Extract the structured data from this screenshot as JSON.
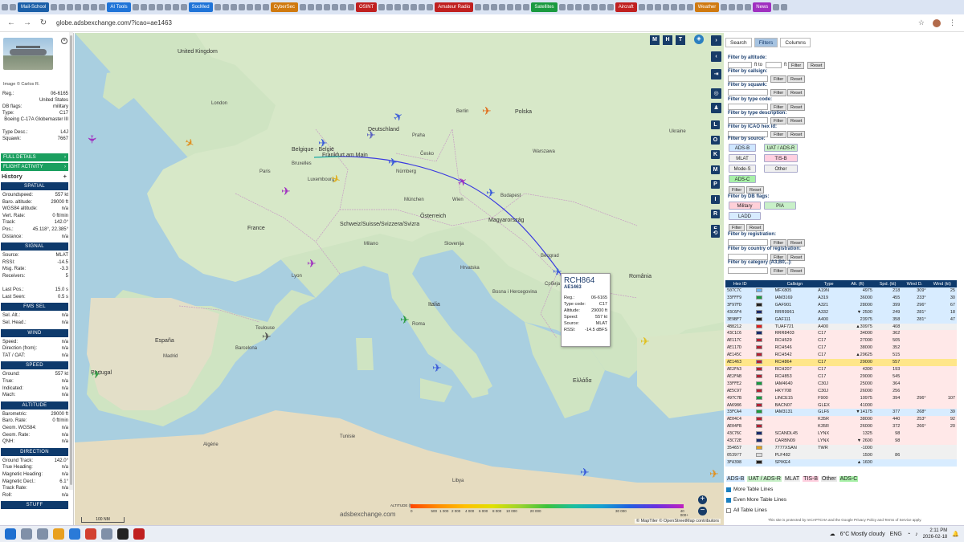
{
  "bookmarks": [
    {
      "label": "Mail-School",
      "color": "#1b5fa8"
    },
    {
      "label": "AI Tools",
      "color": "#1f74d8"
    },
    {
      "label": "SocMed",
      "color": "#1f74d8"
    },
    {
      "label": "CyberSec",
      "color": "#d07a10"
    },
    {
      "label": "OSINT",
      "color": "#c02020"
    },
    {
      "label": "Amateur Radio",
      "color": "#c02020"
    },
    {
      "label": "Satellites",
      "color": "#1a9a40"
    },
    {
      "label": "Aircraft",
      "color": "#c02020"
    },
    {
      "label": "Weather",
      "color": "#d07a10"
    },
    {
      "label": "News",
      "color": "#a030c0"
    }
  ],
  "browser": {
    "url": "globe.adsbexchange.com/?icao=ae1463",
    "back": "←",
    "forward": "→",
    "reload": "↻"
  },
  "left": {
    "photo_credit": "Image © Carlos R.",
    "info": [
      {
        "k": "Reg.:",
        "v": "06-6165"
      },
      {
        "k": "",
        "v": "United States"
      },
      {
        "k": "DB flags:",
        "v": "military"
      },
      {
        "k": "Type:",
        "v": "C17"
      },
      {
        "k": "",
        "v": "Boeing C-17A Globemaster III"
      },
      {
        "k": "Type Desc.:",
        "v": "L4J"
      },
      {
        "k": "Squawk:",
        "v": "7667"
      }
    ],
    "full_details": "FULL DETAILS",
    "flight_activity": "FLIGHT ACTIVITY",
    "history": "History",
    "sections": [
      {
        "title": "SPATIAL",
        "rows": [
          [
            "Groundspeed:",
            "557 kt"
          ],
          [
            "Baro. altitude:",
            "29000 ft"
          ],
          [
            "WGS84 altitude:",
            "n/a"
          ],
          [
            "Vert. Rate:",
            "0 ft/min"
          ],
          [
            "Track:",
            "142.0°"
          ],
          [
            "Pos.:",
            "45.118°, 22.385°"
          ],
          [
            "Distance:",
            "n/a"
          ]
        ]
      },
      {
        "title": "SIGNAL",
        "rows": [
          [
            "Source:",
            "MLAT"
          ],
          [
            "RSSI:",
            "-14.5"
          ],
          [
            "Msg. Rate:",
            "-3.3"
          ],
          [
            "Receivers:",
            "5"
          ],
          [
            "",
            ""
          ],
          [
            "Last Pos.:",
            "15.0 s"
          ],
          [
            "Last Seen:",
            "0.5 s"
          ]
        ]
      },
      {
        "title": "FMS SEL",
        "rows": [
          [
            "Sel. Alt.:",
            "n/a"
          ],
          [
            "Sel. Head.:",
            "n/a"
          ]
        ]
      },
      {
        "title": "WIND",
        "rows": [
          [
            "Speed:",
            "n/a"
          ],
          [
            "Direction (from):",
            "n/a"
          ],
          [
            "TAT / OAT:",
            "n/a"
          ]
        ]
      },
      {
        "title": "SPEED",
        "rows": [
          [
            "Ground:",
            "557 kt"
          ],
          [
            "True:",
            "n/a"
          ],
          [
            "Indicated:",
            "n/a"
          ],
          [
            "Mach:",
            "n/a"
          ]
        ]
      },
      {
        "title": "ALTITUDE",
        "rows": [
          [
            "Barometric:",
            "29000 ft"
          ],
          [
            "Baro. Rate:",
            "0 ft/min"
          ],
          [
            "Geom. WGS84:",
            "n/a"
          ],
          [
            "Geom. Rate:",
            "n/a"
          ],
          [
            "QNH:",
            "n/a"
          ]
        ]
      },
      {
        "title": "DIRECTION",
        "rows": [
          [
            "Ground Track:",
            "142.0°"
          ],
          [
            "True Heading:",
            "n/a"
          ],
          [
            "Magnetic Heading:",
            "n/a"
          ],
          [
            "Magnetic Decl.:",
            "6.1°"
          ],
          [
            "Track Rate:",
            "n/a"
          ],
          [
            "Roll:",
            "n/a"
          ]
        ]
      },
      {
        "title": "STUFF",
        "rows": []
      }
    ]
  },
  "map": {
    "labels": [
      {
        "t": "United Kingdom"
      },
      {
        "t": "Deutschland"
      },
      {
        "t": "Belgique - België"
      },
      {
        "t": "Frankfurt am Main"
      },
      {
        "t": "Polska"
      },
      {
        "t": "France"
      },
      {
        "t": "Österreich"
      },
      {
        "t": "Schweiz/Suisse/Svizzera/Svizra"
      },
      {
        "t": "Magyarország"
      },
      {
        "t": "Italia"
      },
      {
        "t": "România"
      },
      {
        "t": "España"
      },
      {
        "t": "Portugal"
      },
      {
        "t": "Ελλάδα"
      },
      {
        "t": "Slovenija"
      },
      {
        "t": "Hrvatska"
      },
      {
        "t": "Tunisie"
      },
      {
        "t": "Algérie"
      },
      {
        "t": "Libya"
      },
      {
        "t": "Ukraine"
      },
      {
        "t": "Nürnberg"
      },
      {
        "t": "München"
      },
      {
        "t": "Wien"
      },
      {
        "t": "Praha"
      },
      {
        "t": "Česko"
      },
      {
        "t": "Beograd"
      },
      {
        "t": "Budapest"
      },
      {
        "t": "Roma"
      },
      {
        "t": "Milano"
      },
      {
        "t": "Lyon"
      },
      {
        "t": "Paris"
      },
      {
        "t": "Madrid"
      },
      {
        "t": "Barcelona"
      },
      {
        "t": "London"
      },
      {
        "t": "Bruxelles"
      },
      {
        "t": "Luxembourg"
      },
      {
        "t": "Berlin"
      },
      {
        "t": "Warszawa"
      },
      {
        "t": "Bosna i Hercegovina"
      },
      {
        "t": "Србија"
      },
      {
        "t": "Toulouse"
      }
    ],
    "top_ctrl": [
      "M",
      "H",
      "T"
    ],
    "side_ctrl": [
      "L",
      "O",
      "K",
      "M",
      "P",
      "I",
      "R",
      "F"
    ],
    "popup": {
      "callsign": "RCH864",
      "hex": "AE1463",
      "rows": [
        [
          "Reg.:",
          "06-6165"
        ],
        [
          "Type code:",
          "C17"
        ],
        [
          "Altitude:",
          "29000 ft"
        ],
        [
          "Speed:",
          "557 kt"
        ],
        [
          "Source:",
          "MLAT"
        ],
        [
          "RSSI:",
          "-14.5 dBFS"
        ]
      ]
    },
    "altitude_label": "ALTITUDE (ft)",
    "altitude_ticks": [
      "0",
      "500",
      "1 000",
      "2 000",
      "4 000",
      "6 000",
      "8 000",
      "10 000",
      "20 000",
      "30 000",
      "40 000+"
    ],
    "watermark": "adsbexchange.com",
    "scale": "100 NM",
    "attribution": "© MapTiler © OpenStreetMap contributors",
    "zoom_in": "+",
    "zoom_out": "−"
  },
  "right": {
    "tabs": [
      "Search",
      "Filters",
      "Columns"
    ],
    "filters": [
      {
        "title": "Filter by altitude:",
        "buttons": [
          "Filter",
          "Reset"
        ],
        "mid": "ft to",
        "unit": "ft"
      },
      {
        "title": "Filter by callsign:",
        "buttons": [
          "Filter",
          "Reset"
        ]
      },
      {
        "title": "Filter by squawk:",
        "buttons": [
          "Filter",
          "Reset"
        ]
      },
      {
        "title": "Filter by type code:",
        "buttons": [
          "Filter",
          "Reset"
        ]
      },
      {
        "title": "Filter by type description:",
        "buttons": [
          "Filter",
          "Reset"
        ]
      },
      {
        "title": "Filter by ICAO hex id:",
        "buttons": [
          "Filter",
          "Reset"
        ]
      }
    ],
    "source_title": "Filter by source:",
    "sources": [
      {
        "label": "ADS-B",
        "color": "#cfe6ff"
      },
      {
        "label": "UAT / ADS-R",
        "color": "#c8f0c8"
      },
      {
        "label": "MLAT",
        "color": "#f0f0f0"
      },
      {
        "label": "TIS-B",
        "color": "#ffd0e0"
      },
      {
        "label": "Mode-S",
        "color": "#f0f0f0"
      },
      {
        "label": "Other",
        "color": "#f0f0f0"
      },
      {
        "label": "ADS-C",
        "color": "#a8f0a8"
      }
    ],
    "dbflags_title": "Filter by DB flags:",
    "dbflags": [
      {
        "label": "Military",
        "color": "#ffd0d8"
      },
      {
        "label": "PIA",
        "color": "#c8f0c8"
      },
      {
        "label": "LADD",
        "color": "#d8ecff"
      }
    ],
    "filter_btn": "Filter",
    "reset_btn": "Reset",
    "reg_title": "Filter by registration:",
    "country_title": "Filter by country of registration:",
    "cat_title": "Filter by category (A3,B0,..):",
    "columns": [
      "Hex ID",
      "",
      "Callsign",
      "Type",
      "Alt. (ft)",
      "Spd. (kt)",
      "Wind D.",
      "Wind (kt)"
    ],
    "rows": [
      {
        "hex": "507C7C",
        "flag": "#6cb4ee",
        "cs": "MFX805",
        "type": "A19N",
        "alt": "4975",
        "spd": "218",
        "wd": "309°",
        "ws": "25",
        "bg": "#d8ecff"
      },
      {
        "hex": "33FFF9",
        "flag": "#1a9a40",
        "cs": "IAM3169",
        "type": "A319",
        "alt": "36000",
        "spd": "455",
        "wd": "233°",
        "ws": "30",
        "bg": "#d8ecff"
      },
      {
        "hex": "3F97FD",
        "flag": "#222",
        "cs": "GAF901",
        "type": "A321",
        "alt": "28000",
        "spd": "399",
        "wd": "296°",
        "ws": "67",
        "bg": "#d8ecff"
      },
      {
        "hex": "43C6F4",
        "flag": "#1a2a6c",
        "cs": "RRR9961",
        "type": "A332",
        "alt": "▼ 2500",
        "spd": "249",
        "wd": "281°",
        "ws": "18",
        "bg": "#d8ecff"
      },
      {
        "hex": "3E9BF7",
        "flag": "#222",
        "cs": "GAF111",
        "type": "A400",
        "alt": "23975",
        "spd": "358",
        "wd": "281°",
        "ws": "47",
        "bg": "#d8ecff"
      },
      {
        "hex": "4B8212",
        "flag": "#e02020",
        "cs": "TUAF721",
        "type": "A400",
        "alt": "▲30975",
        "spd": "408",
        "wd": "",
        "ws": "",
        "bg": "#f0f0f0"
      },
      {
        "hex": "43C1C6",
        "flag": "#1a2a6c",
        "cs": "RRR8403",
        "type": "C17",
        "alt": "34000",
        "spd": "362",
        "wd": "",
        "ws": "",
        "bg": "#ffe8e8"
      },
      {
        "hex": "AE117C",
        "flag": "#b22234",
        "cs": "RCH529",
        "type": "C17",
        "alt": "27000",
        "spd": "505",
        "wd": "",
        "ws": "",
        "bg": "#ffe8e8"
      },
      {
        "hex": "AE117D",
        "flag": "#b22234",
        "cs": "RCH546",
        "type": "C17",
        "alt": "38000",
        "spd": "352",
        "wd": "",
        "ws": "",
        "bg": "#ffe8e8"
      },
      {
        "hex": "AE145C",
        "flag": "#b22234",
        "cs": "RCH542",
        "type": "C17",
        "alt": "▲29625",
        "spd": "515",
        "wd": "",
        "ws": "",
        "bg": "#ffe8e8"
      },
      {
        "hex": "AE1463",
        "flag": "#b22234",
        "cs": "RCH864",
        "type": "C17",
        "alt": "29000",
        "spd": "557",
        "wd": "",
        "ws": "",
        "bg": "#ffe68a"
      },
      {
        "hex": "AE2FA3",
        "flag": "#b22234",
        "cs": "RCH207",
        "type": "C17",
        "alt": "4300",
        "spd": "193",
        "wd": "",
        "ws": "",
        "bg": "#ffe8e8"
      },
      {
        "hex": "AE2FAB",
        "flag": "#b22234",
        "cs": "RCH853",
        "type": "C17",
        "alt": "29000",
        "spd": "545",
        "wd": "",
        "ws": "",
        "bg": "#ffe8e8"
      },
      {
        "hex": "33FFE2",
        "flag": "#1a9a40",
        "cs": "IAM4640",
        "type": "C30J",
        "alt": "25000",
        "spd": "364",
        "wd": "",
        "ws": "",
        "bg": "#ffe8e8"
      },
      {
        "hex": "AE5C97",
        "flag": "#b22234",
        "cs": "HKY708",
        "type": "C30J",
        "alt": "26000",
        "spd": "256",
        "wd": "",
        "ws": "",
        "bg": "#ffe8e8"
      },
      {
        "hex": "497C7B",
        "flag": "#1a9a40",
        "cs": "LINCE15",
        "type": "F900",
        "alt": "10975",
        "spd": "394",
        "wd": "296°",
        "ws": "107",
        "bg": "#ffe8e8"
      },
      {
        "hex": "AA6986",
        "flag": "#b22234",
        "cs": "BACN07",
        "type": "GLEX",
        "alt": "41000",
        "spd": "",
        "wd": "",
        "ws": "",
        "bg": "#ffe8e8"
      },
      {
        "hex": "33FCA4",
        "flag": "#1a9a40",
        "cs": "IAM3131",
        "type": "GLF6",
        "alt": "▼14175",
        "spd": "377",
        "wd": "268°",
        "ws": "39",
        "bg": "#d8ecff"
      },
      {
        "hex": "AE04C4",
        "flag": "#b22234",
        "cs": "",
        "type": "K35R",
        "alt": "38000",
        "spd": "440",
        "wd": "253°",
        "ws": "92",
        "bg": "#ffe8e8"
      },
      {
        "hex": "AE04FB",
        "flag": "#b22234",
        "cs": "",
        "type": "K35R",
        "alt": "26000",
        "spd": "372",
        "wd": "266°",
        "ws": "20",
        "bg": "#ffe8e8"
      },
      {
        "hex": "43C76C",
        "flag": "#1a2a6c",
        "cs": "SCANDL45",
        "type": "LYNX",
        "alt": "1325",
        "spd": "98",
        "wd": "",
        "ws": "",
        "bg": "#ffe8e8"
      },
      {
        "hex": "43C72E",
        "flag": "#1a2a6c",
        "cs": "CARBN09",
        "type": "LYNX",
        "alt": "▼ 2600",
        "spd": "98",
        "wd": "",
        "ws": "",
        "bg": "#ffe8e8"
      },
      {
        "hex": "354657",
        "flag": "#e0a020",
        "cs": "7777XSAN",
        "type": "TWR",
        "alt": "-1000",
        "spd": "",
        "wd": "",
        "ws": "",
        "bg": "#f0f0f0"
      },
      {
        "hex": "0539?7",
        "flag": "#dddddd",
        "cs": "PLF482",
        "type": "",
        "alt": "1500",
        "spd": "86",
        "wd": "",
        "ws": "",
        "bg": "#f0f0f0"
      },
      {
        "hex": "3FA398",
        "flag": "#222",
        "cs": "SPIKE4",
        "type": "",
        "alt": "▲ 1600",
        "spd": "",
        "wd": "",
        "ws": "",
        "bg": "#d8ecff"
      }
    ],
    "legend": [
      {
        "label": "ADS-B",
        "bg": "#cfe6ff"
      },
      {
        "label": "UAT / ADS-R",
        "bg": "#c8f0c8"
      },
      {
        "label": "MLAT",
        "bg": "#f0f0f0"
      },
      {
        "label": "TIS-B",
        "bg": "#ffd0e0"
      },
      {
        "label": "Other",
        "bg": "#e8e8e8"
      },
      {
        "label": "ADS-C",
        "bg": "#a8f0a8"
      }
    ],
    "checks": [
      {
        "label": "More Table Lines",
        "on": true
      },
      {
        "label": "Even More Table Lines",
        "on": true
      },
      {
        "label": "All Table Lines",
        "on": false
      }
    ],
    "recaptcha": "This site is protected by reCAPTCHA and the Google Privacy Policy and Terms of Service apply."
  },
  "taskbar": {
    "weather": "6°C  Mostly cloudy",
    "lang": "ENG",
    "time": "2:11 PM",
    "date": "2026-02-18"
  }
}
